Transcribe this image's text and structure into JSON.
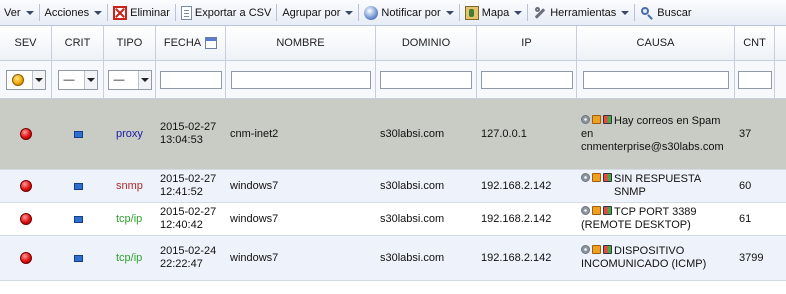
{
  "toolbar": {
    "items": [
      {
        "label": "Ver",
        "icon": "",
        "dropdown": true
      },
      {
        "label": "Acciones",
        "icon": "",
        "dropdown": true
      },
      {
        "label": "Eliminar",
        "icon": "delete-icon",
        "dropdown": false
      },
      {
        "label": "Exportar a CSV",
        "icon": "export-icon",
        "dropdown": false
      },
      {
        "label": "Agrupar por",
        "icon": "",
        "dropdown": true
      },
      {
        "label": "Notificar por",
        "icon": "notify-icon",
        "dropdown": true
      },
      {
        "label": "Mapa",
        "icon": "map-icon",
        "dropdown": true
      },
      {
        "label": "Herramientas",
        "icon": "tools-icon",
        "dropdown": true
      },
      {
        "label": "Buscar",
        "icon": "search-icon",
        "dropdown": false
      }
    ]
  },
  "columns": [
    "SEV",
    "CRIT",
    "TIPO",
    "FECHA",
    "NOMBRE",
    "DOMINIO",
    "IP",
    "CAUSA",
    "CNT"
  ],
  "filters": {
    "crit_value": "—",
    "tipo_value": "—"
  },
  "rows": [
    {
      "selected": true,
      "tipo": "proxy",
      "tipo_color": "#1a1aa8",
      "fecha_date": "2015-02-27",
      "fecha_time": "13:04:53",
      "nombre": "cnm-inet2",
      "dominio": "s30labsi.com",
      "ip": "127.0.0.1",
      "causa_line1": "Hay correos en Spam",
      "causa_line2": "en cnmenterprise@s30labs.com",
      "cnt": "37"
    },
    {
      "selected": false,
      "tipo": "snmp",
      "tipo_color": "#b02a2a",
      "fecha_date": "2015-02-27",
      "fecha_time": "12:41:52",
      "nombre": "windows7",
      "dominio": "s30labsi.com",
      "ip": "192.168.2.142",
      "causa_line1": "SIN RESPUESTA SNMP",
      "causa_line2": "",
      "cnt": "60"
    },
    {
      "selected": false,
      "tipo": "tcp/ip",
      "tipo_color": "#2ea22e",
      "fecha_date": "2015-02-27",
      "fecha_time": "12:40:42",
      "nombre": "windows7",
      "dominio": "s30labsi.com",
      "ip": "192.168.2.142",
      "causa_line1": "TCP PORT 3389",
      "causa_line2": "(REMOTE DESKTOP)",
      "cnt": "61"
    },
    {
      "selected": false,
      "tipo": "tcp/ip",
      "tipo_color": "#2ea22e",
      "fecha_date": "2015-02-24",
      "fecha_time": "22:22:47",
      "nombre": "windows7",
      "dominio": "s30labsi.com",
      "ip": "192.168.2.142",
      "causa_line1": "DISPOSITIVO",
      "causa_line2": "INCOMUNICADO (ICMP)",
      "cnt": "3799"
    }
  ],
  "colors": {
    "selected_row": "#c9ccc4",
    "alt_row": "#eef2fa",
    "row": "#ffffff"
  }
}
